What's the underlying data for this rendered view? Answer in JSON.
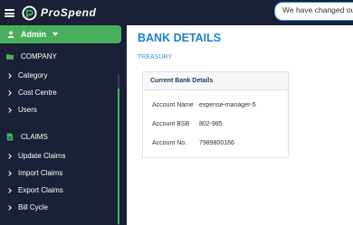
{
  "app": {
    "brand": "ProSpend",
    "notice": "We have changed our n"
  },
  "sidebar": {
    "user": "Admin",
    "sections": [
      {
        "title": "COMPANY",
        "items": [
          "Category",
          "Cost Centre",
          "Users"
        ]
      },
      {
        "title": "CLAIMS",
        "items": [
          "Update Claims",
          "Import Claims",
          "Export Claims",
          "Bill Cycle"
        ]
      }
    ]
  },
  "page": {
    "title": "BANK DETAILS",
    "breadcrumb": "TREASURY"
  },
  "bank": {
    "header": "Current Bank Details",
    "rows": [
      {
        "label": "Account Name",
        "value": "expense-manager-5"
      },
      {
        "label": "Account BSB",
        "value": "802-985"
      },
      {
        "label": "Account No.",
        "value": "7989800166"
      }
    ]
  },
  "colors": {
    "navy": "#1a2035",
    "accent_green": "#48b05c",
    "title_blue": "#1f7fd0"
  }
}
